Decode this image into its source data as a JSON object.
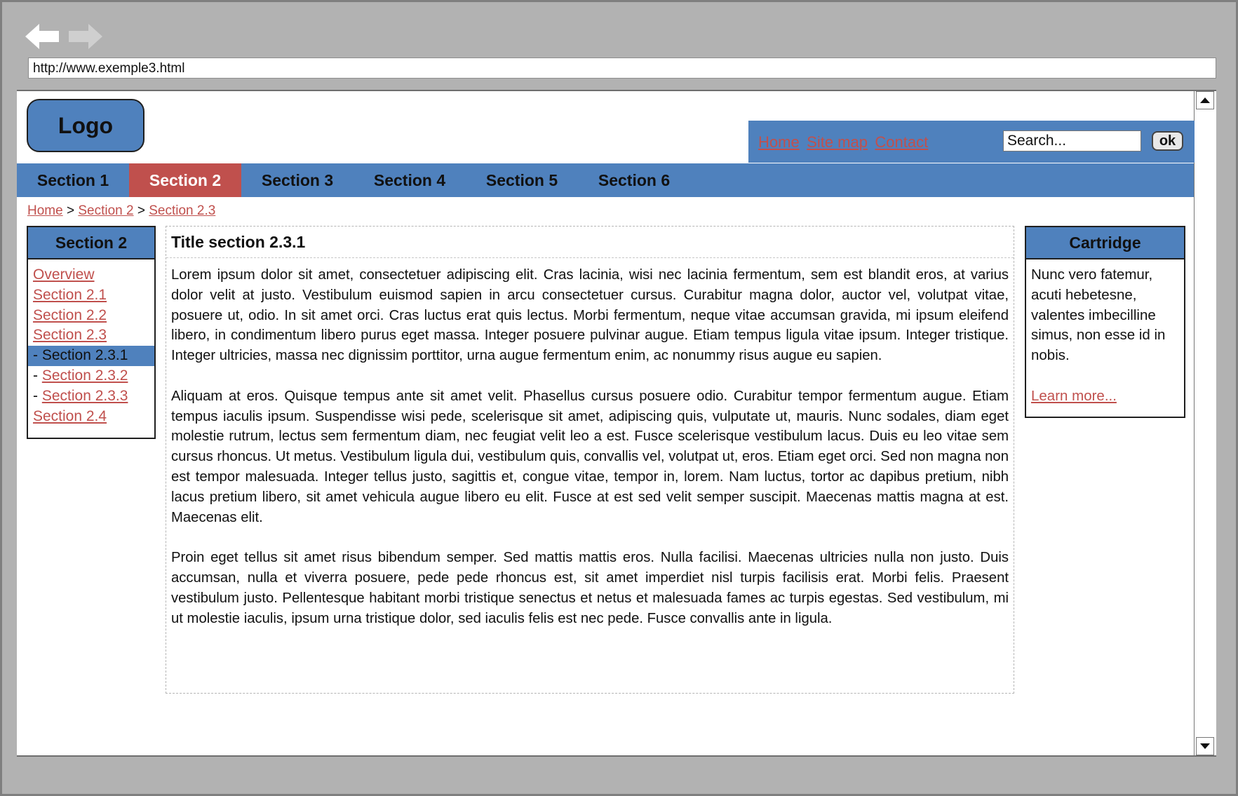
{
  "browser": {
    "url": "http://www.exemple3.html"
  },
  "header": {
    "logo": "Logo",
    "top_links": [
      "Home",
      "Site map",
      "Contact"
    ],
    "search_value": "Search...",
    "ok_label": "ok"
  },
  "sections": {
    "tabs": [
      "Section 1",
      "Section 2",
      "Section 3",
      "Section 4",
      "Section 5",
      "Section 6"
    ],
    "active_index": 1
  },
  "breadcrumb": {
    "items": [
      "Home",
      "Section 2",
      "Section 2.3"
    ],
    "separator": ">"
  },
  "left_nav": {
    "title": "Section 2",
    "items": [
      {
        "label": "Overview",
        "prefix": ""
      },
      {
        "label": "Section 2.1",
        "prefix": ""
      },
      {
        "label": "Section 2.2",
        "prefix": ""
      },
      {
        "label": "Section 2.3",
        "prefix": ""
      },
      {
        "label": "Section 2.3.1",
        "prefix": "- "
      },
      {
        "label": "Section 2.3.2",
        "prefix": "- "
      },
      {
        "label": "Section 2.3.3",
        "prefix": "- "
      },
      {
        "label": "Section 2.4",
        "prefix": ""
      }
    ],
    "active_index": 4
  },
  "main": {
    "title": "Title section 2.3.1",
    "paragraphs": [
      "Lorem ipsum dolor sit amet, consectetuer adipiscing elit. Cras lacinia, wisi nec lacinia fermentum, sem est blandit eros, at varius dolor velit at justo. Vestibulum euismod sapien in arcu consectetuer cursus. Curabitur magna dolor, auctor vel, volutpat vitae, posuere ut, odio. In sit amet orci. Cras luctus erat quis lectus. Morbi fermentum, neque vitae accumsan gravida, mi ipsum eleifend libero, in condimentum libero purus eget massa. Integer posuere pulvinar augue. Etiam tempus ligula vitae ipsum. Integer tristique. Integer ultricies, massa nec dignissim porttitor, urna augue fermentum enim, ac nonummy risus augue eu sapien.",
      "Aliquam at eros. Quisque tempus ante sit amet velit. Phasellus cursus posuere odio. Curabitur tempor fermentum augue. Etiam tempus iaculis ipsum. Suspendisse wisi pede, scelerisque sit amet, adipiscing quis, vulputate ut, mauris. Nunc sodales, diam eget molestie rutrum, lectus sem fermentum diam, nec feugiat velit leo a est. Fusce scelerisque vestibulum lacus. Duis eu leo vitae sem cursus rhoncus. Ut metus. Vestibulum ligula dui, vestibulum quis, convallis vel, volutpat ut, eros. Etiam eget orci. Sed non magna non est tempor malesuada. Integer tellus justo, sagittis et, congue vitae, tempor in, lorem. Nam luctus, tortor ac dapibus pretium, nibh lacus pretium libero, sit amet vehicula augue libero eu elit. Fusce at est sed velit semper suscipit. Maecenas mattis magna at est. Maecenas elit.",
      "Proin eget tellus sit amet risus bibendum semper. Sed mattis mattis eros. Nulla facilisi. Maecenas ultricies nulla non justo. Duis accumsan, nulla et viverra posuere, pede pede rhoncus est, sit amet imperdiet nisl turpis facilisis erat. Morbi felis. Praesent vestibulum justo. Pellentesque habitant morbi tristique senectus et netus et malesuada fames ac turpis egestas. Sed vestibulum, mi ut molestie iaculis, ipsum urna tristique dolor, sed iaculis felis est nec pede. Fusce convallis ante in ligula."
    ]
  },
  "cartridge": {
    "title": "Cartridge",
    "text": "Nunc vero fatemur, acuti hebetesne, valentes imbecilline simus, non esse id in nobis.",
    "link": "Learn more..."
  },
  "colors": {
    "accent": "#4f81bd",
    "active": "#c0504d",
    "link": "#c0504d",
    "chrome": "#b2b2b2"
  }
}
